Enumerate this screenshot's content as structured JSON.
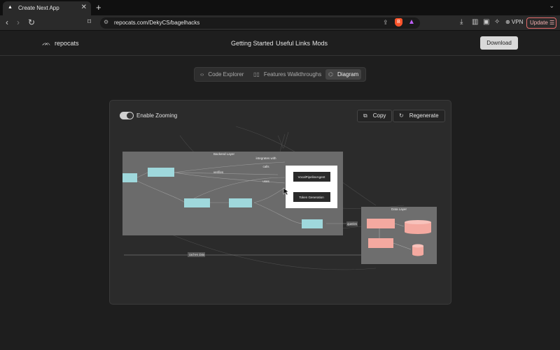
{
  "browser": {
    "tab_title": "Create Next App",
    "tab_close": "✕",
    "new_tab": "+",
    "tabs_menu": "⌄",
    "url": "repocats.com/DekyCS/bagelhacks",
    "vpn_label": "⊕ VPN",
    "update_label": "Update ☰"
  },
  "header": {
    "logo_text": "repocats",
    "nav": [
      "Getting Started",
      "Useful Links",
      "Mods"
    ],
    "download_label": "Download"
  },
  "segmented": {
    "items": [
      {
        "label": "Code Explorer",
        "icon": "code-icon"
      },
      {
        "label": "Features Walkthroughs",
        "icon": "book-icon"
      },
      {
        "label": "Diagram",
        "icon": "diagram-icon"
      }
    ],
    "active": "Diagram"
  },
  "card": {
    "toggle_label": "Enable Zooming",
    "toggle_on": true,
    "copy_label": "Copy",
    "regenerate_label": "Regenerate"
  },
  "diagram": {
    "backend_title": "Backend Layer",
    "data_title": "Data Layer",
    "edge_labels": {
      "integrates": "integrates with",
      "calls": "calls",
      "uses": "uses",
      "verifies": "verifies",
      "queries": "queries",
      "caches": "caches data"
    },
    "agent_node_1": "VocalPipelineAgent",
    "agent_node_2": "Token Generation",
    "colors": {
      "backend_bg": "#6b6b6b",
      "node_blue": "#9fd8dc",
      "node_salmon": "#f4a9a0",
      "data_bg": "#6e6e6e"
    }
  }
}
